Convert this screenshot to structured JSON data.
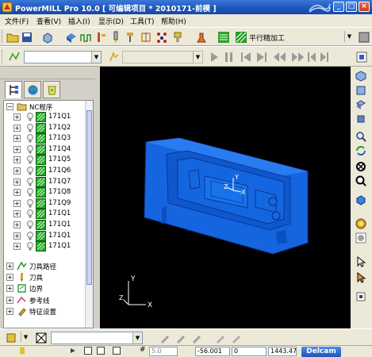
{
  "window": {
    "title": "PowerMILL Pro 10.0   [ 可编辑项目 * 2010171-前模 ]",
    "minimize_label": "_",
    "maximize_label": "□",
    "close_label": "×"
  },
  "menu": [
    "文件(F)",
    "查看(V)",
    "插入(I)",
    "显示(D)",
    "工具(T)",
    "帮助(H)"
  ],
  "toolbar1": {
    "strategy_label": "平行精加工",
    "icons": [
      "open-folder-icon",
      "save-icon",
      "stock-icon",
      "block-icon",
      "toolpath-icon",
      "feed-icon",
      "tool-icon",
      "drill-icon",
      "boundary-icon",
      "pattern-icon",
      "leadin-icon",
      "simulate-icon",
      "strategy-icon"
    ]
  },
  "toolbar2": {
    "playback_icons": [
      "play-icon",
      "pause-icon",
      "step-back-icon",
      "step-forward-icon",
      "rewind-icon",
      "fast-forward-icon",
      "go-start-icon",
      "go-end-icon"
    ]
  },
  "explorer": {
    "tabs": [
      "tree-view-icon",
      "globe-icon",
      "recycle-icon"
    ],
    "root": {
      "label": "NC程序",
      "expander": "−"
    },
    "nc_programs": [
      "171Q1",
      "171Q2",
      "171Q3",
      "171Q4",
      "171Q5",
      "171Q6",
      "171Q7",
      "171Q8",
      "171Q9",
      "171Q1",
      "171Q1",
      "171Q1",
      "171Q1"
    ],
    "folders": [
      {
        "label": "刀具路径",
        "expander": "+"
      },
      {
        "label": "刀具",
        "expander": "+"
      },
      {
        "label": "边界",
        "expander": "+"
      },
      {
        "label": "参考线",
        "expander": "+"
      },
      {
        "label": "特征设置",
        "expander": "+"
      }
    ]
  },
  "viewport": {
    "background": "#000000",
    "part_color": "#1a6fe8",
    "axis_labels": {
      "x": "X",
      "y": "Y",
      "z": "Z"
    }
  },
  "status": {
    "fields": [
      "5.0",
      "-56.001",
      "0",
      "1443.47"
    ],
    "brand_button": "Delcam"
  },
  "colors": {
    "title_bar": "#1c54b8",
    "toolbar": "#ece9d8",
    "tree_icon_green": "#28a828"
  }
}
